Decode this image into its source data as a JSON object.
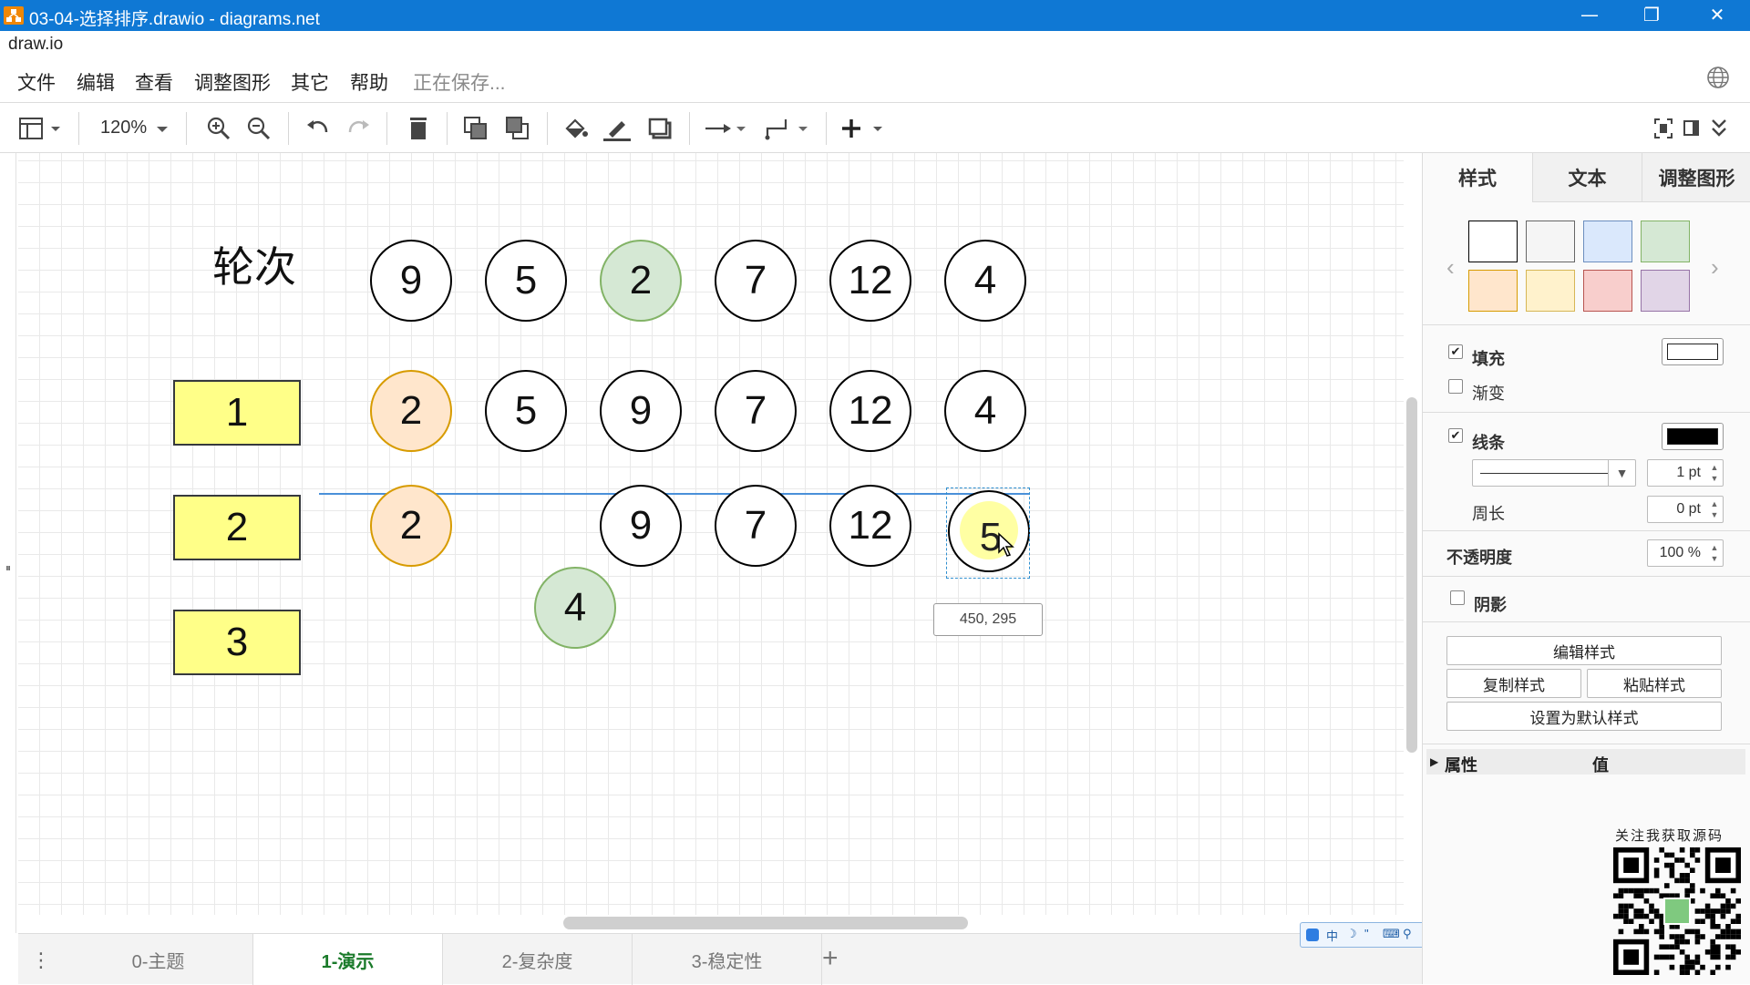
{
  "window": {
    "title": "03-04-选择排序.drawio - diagrams.net",
    "minimize_glyph": "—",
    "restore_glyph": "❐",
    "close_glyph": "✕"
  },
  "app_name": "draw.io",
  "menu": {
    "items": [
      "文件",
      "编辑",
      "查看",
      "调整图形",
      "其它",
      "帮助"
    ],
    "status": "正在保存..."
  },
  "toolbar": {
    "zoom": "120%",
    "icons": [
      "layout-icon",
      "zoom-in-icon",
      "zoom-out-icon",
      "undo-icon",
      "redo-icon",
      "delete-icon",
      "to-front-icon",
      "to-back-icon",
      "fill-color-icon",
      "line-color-icon",
      "shadow-icon",
      "connection-icon",
      "waypoint-icon",
      "insert-icon",
      "fullscreen-icon",
      "format-panel-icon",
      "collapse-icon"
    ]
  },
  "diagram": {
    "header_label": "轮次",
    "rows": [
      {
        "label": "",
        "cells": [
          {
            "value": "9",
            "style": "plain"
          },
          {
            "value": "5",
            "style": "plain"
          },
          {
            "value": "2",
            "style": "green"
          },
          {
            "value": "7",
            "style": "plain"
          },
          {
            "value": "12",
            "style": "plain"
          },
          {
            "value": "4",
            "style": "plain"
          }
        ]
      },
      {
        "label": "1",
        "cells": [
          {
            "value": "2",
            "style": "orange"
          },
          {
            "value": "5",
            "style": "plain"
          },
          {
            "value": "9",
            "style": "plain"
          },
          {
            "value": "7",
            "style": "plain"
          },
          {
            "value": "12",
            "style": "plain"
          },
          {
            "value": "4",
            "style": "plain"
          }
        ]
      },
      {
        "label": "2",
        "cells": [
          {
            "value": "2",
            "style": "orange"
          },
          {
            "value": "9",
            "style": "plain"
          },
          {
            "value": "7",
            "style": "plain"
          },
          {
            "value": "12",
            "style": "plain"
          }
        ]
      },
      {
        "label": "3",
        "cells": []
      }
    ],
    "dragging_value": "5",
    "loose_value": "4",
    "coord_tooltip": "450, 295"
  },
  "pages": {
    "tabs": [
      "0-主题",
      "1-演示",
      "2-复杂度",
      "3-稳定性"
    ],
    "active_index": 1,
    "add_label": "+"
  },
  "ime": {
    "items": [
      "中",
      "☽",
      "\"",
      "⌨",
      "⚲",
      "✎"
    ]
  },
  "format_panel": {
    "tabs": [
      "样式",
      "文本",
      "调整图形"
    ],
    "active_tab": 0,
    "swatches": [
      {
        "fill": "#ffffff",
        "stroke": "#000000"
      },
      {
        "fill": "#f5f5f5",
        "stroke": "#666666"
      },
      {
        "fill": "#dae8fc",
        "stroke": "#6c8ebf"
      },
      {
        "fill": "#d5e8d4",
        "stroke": "#82b366"
      },
      {
        "fill": "#ffe6cc",
        "stroke": "#d79b00"
      },
      {
        "fill": "#fff2cc",
        "stroke": "#d6b656"
      },
      {
        "fill": "#f8cecc",
        "stroke": "#b85450"
      },
      {
        "fill": "#e1d5e7",
        "stroke": "#9673a6"
      }
    ],
    "fill_label": "填充",
    "fill_checked": true,
    "fill_color": "#ffffff",
    "gradient_label": "渐变",
    "gradient_checked": false,
    "line_label": "线条",
    "line_checked": true,
    "line_color": "#000000",
    "line_width": "1 pt",
    "perimeter_label": "周长",
    "perimeter_value": "0 pt",
    "opacity_label": "不透明度",
    "opacity_value": "100 %",
    "shadow_label": "阴影",
    "shadow_checked": false,
    "edit_style": "编辑样式",
    "copy_style": "复制样式",
    "paste_style": "粘贴样式",
    "set_default": "设置为默认样式",
    "prop_col": "属性",
    "value_col": "值"
  },
  "qr_caption": "关注我获取源码",
  "colors": {
    "titlebar": "#0f78d4",
    "orange_fill": "#ffe6cc",
    "green_fill": "#d5e8d4",
    "yellow_rect": "#ffff88",
    "active_tab_text": "#1a7a2a"
  }
}
